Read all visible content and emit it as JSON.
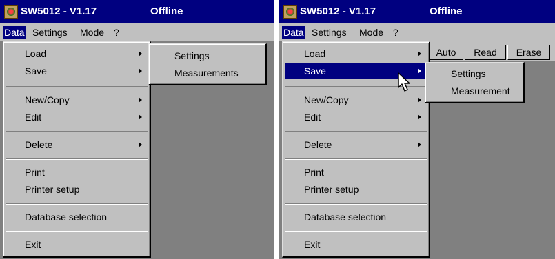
{
  "left_screen": {
    "title": "SW5012 - V1.17",
    "status": "Offline",
    "menubar": [
      "Data",
      "Settings",
      "Mode",
      "?"
    ],
    "data_menu": {
      "load": "Load",
      "save": "Save",
      "new_copy": "New/Copy",
      "edit": "Edit",
      "delete": "Delete",
      "print": "Print",
      "printer_setup": "Printer setup",
      "database_selection": "Database selection",
      "exit": "Exit"
    },
    "submenu": [
      "Settings",
      "Measurements"
    ]
  },
  "right_screen": {
    "title": "SW5012 - V1.17",
    "status": "Offline",
    "menubar": [
      "Data",
      "Settings",
      "Mode",
      "?"
    ],
    "toolbar": [
      "Auto",
      "Read",
      "Erase"
    ],
    "data_menu": {
      "load": "Load",
      "save": "Save",
      "new_copy": "New/Copy",
      "edit": "Edit",
      "delete": "Delete",
      "print": "Print",
      "printer_setup": "Printer setup",
      "database_selection": "Database selection",
      "exit": "Exit"
    },
    "submenu": [
      "Settings",
      "Measurement"
    ]
  },
  "colors": {
    "title_bar": "#000080",
    "menu_face": "#c0c0c0",
    "client_area": "#808080",
    "highlight": "#000080"
  }
}
